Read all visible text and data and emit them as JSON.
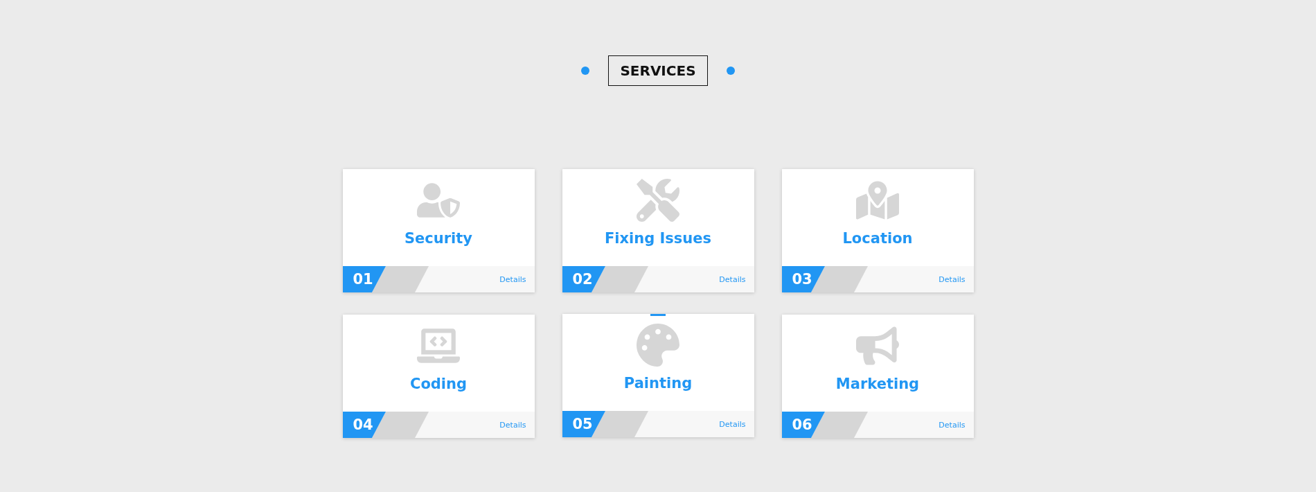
{
  "heading": {
    "title": "SERVICES"
  },
  "services": [
    {
      "title": "Security",
      "number": "01",
      "link": "Details",
      "highlighted": false
    },
    {
      "title": "Fixing Issues",
      "number": "02",
      "link": "Details",
      "highlighted": false
    },
    {
      "title": "Location",
      "number": "03",
      "link": "Details",
      "highlighted": false
    },
    {
      "title": "Coding",
      "number": "04",
      "link": "Details",
      "highlighted": false
    },
    {
      "title": "Painting",
      "number": "05",
      "link": "Details",
      "highlighted": true
    },
    {
      "title": "Marketing",
      "number": "06",
      "link": "Details",
      "highlighted": false
    }
  ]
}
